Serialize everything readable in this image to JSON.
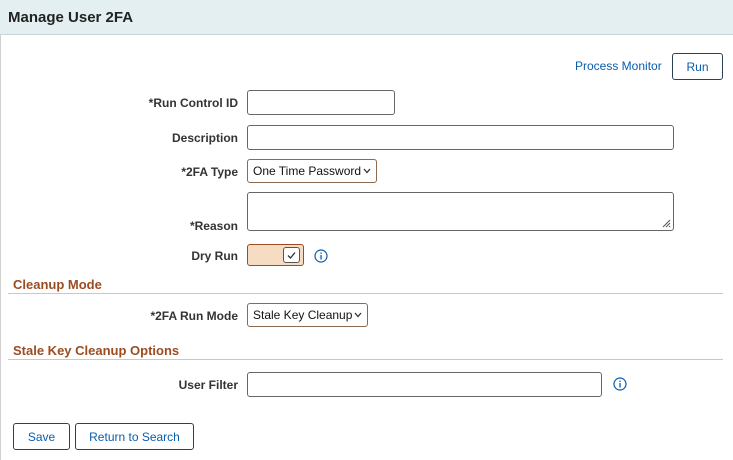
{
  "page": {
    "title": "Manage User 2FA"
  },
  "toolbar": {
    "process_monitor": "Process Monitor",
    "run_label": "Run"
  },
  "form": {
    "run_control_id": {
      "label": "*Run Control ID",
      "value": ""
    },
    "description": {
      "label": "Description",
      "value": ""
    },
    "tfa_type": {
      "label": "*2FA Type",
      "selected": "One Time Password"
    },
    "reason": {
      "label": "*Reason",
      "value": ""
    },
    "dry_run": {
      "label": "Dry Run",
      "checked": true
    }
  },
  "cleanup_mode": {
    "section_title": "Cleanup Mode",
    "run_mode": {
      "label": "*2FA Run Mode",
      "selected": "Stale Key Cleanup"
    }
  },
  "stale_key_options": {
    "section_title": "Stale Key Cleanup Options",
    "user_filter": {
      "label": "User Filter",
      "value": ""
    }
  },
  "footer": {
    "save_label": "Save",
    "return_label": "Return to Search"
  },
  "colors": {
    "header_bg": "#e4eff1",
    "link": "#0b5cad",
    "section_title": "#9a4c22",
    "toggle_bg": "#f7dcc4"
  },
  "icons": {
    "info": "info-circle-icon",
    "check": "check-icon",
    "chevron": "chevron-down-icon",
    "resize": "resize-grip-icon"
  }
}
